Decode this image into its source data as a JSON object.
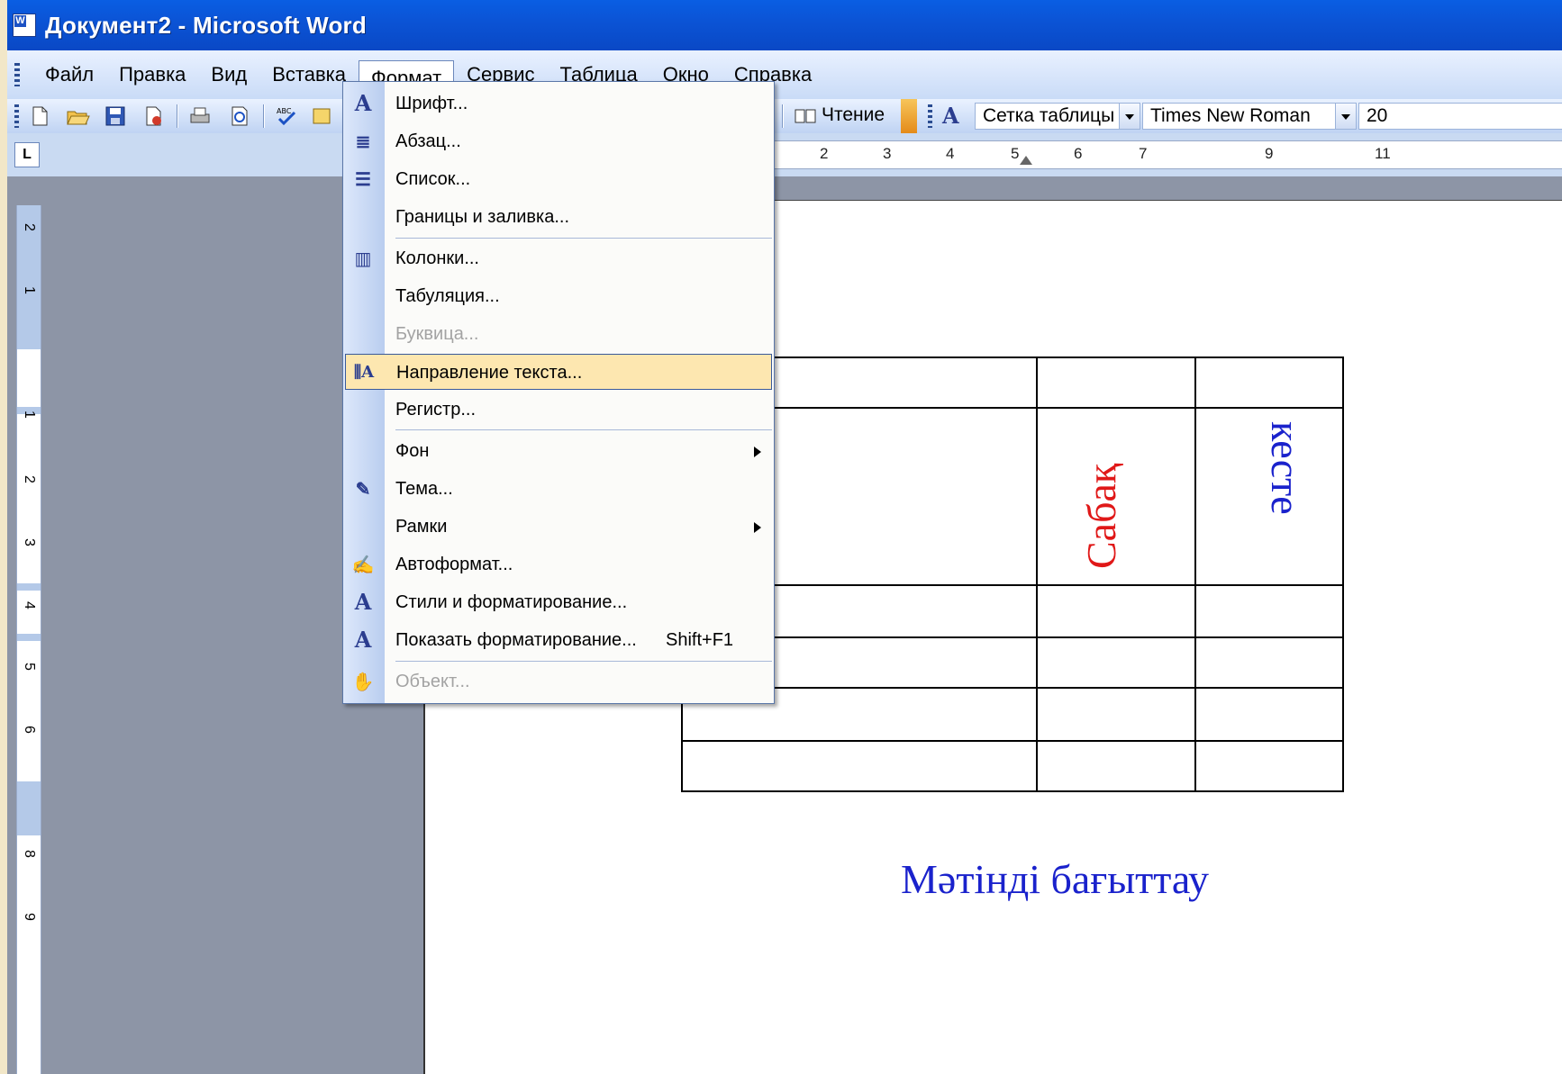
{
  "window": {
    "title": "Документ2 - Microsoft Word"
  },
  "menubar": {
    "items": [
      "Файл",
      "Правка",
      "Вид",
      "Вставка",
      "Формат",
      "Сервис",
      "Таблица",
      "Окно",
      "Справка"
    ],
    "active": "Формат"
  },
  "toolbar": {
    "reading_label": "Чтение",
    "style_value": "Сетка таблицы",
    "font_value": "Times New Roman",
    "size_value": "20"
  },
  "ruler": {
    "h_labels": [
      "2",
      "3",
      "4",
      "5",
      "6",
      "7",
      "9",
      "11"
    ]
  },
  "vruler": {
    "labels": [
      "2",
      "1",
      "1",
      "2",
      "3",
      "4",
      "5",
      "6",
      "8",
      "9"
    ]
  },
  "format_menu": {
    "items": [
      {
        "label": "Шрифт...",
        "icon": "font-icon"
      },
      {
        "label": "Абзац...",
        "icon": "paragraph-icon"
      },
      {
        "label": "Список...",
        "icon": "list-icon"
      },
      {
        "label": "Границы и заливка...",
        "icon": ""
      },
      {
        "label": "Колонки...",
        "icon": "columns-icon"
      },
      {
        "label": "Табуляция...",
        "icon": ""
      },
      {
        "label": "Буквица...",
        "icon": "",
        "disabled": true
      },
      {
        "label": "Направление текста...",
        "icon": "text-direction-icon",
        "highlighted": true
      },
      {
        "label": "Регистр...",
        "icon": ""
      },
      {
        "label": "Фон",
        "icon": "",
        "submenu": true
      },
      {
        "label": "Тема...",
        "icon": "theme-icon"
      },
      {
        "label": "Рамки",
        "icon": "",
        "submenu": true
      },
      {
        "label": "Автоформат...",
        "icon": "autoformat-icon"
      },
      {
        "label": "Стили и форматирование...",
        "icon": "styles-icon"
      },
      {
        "label": "Показать форматирование...",
        "icon": "reveal-formatting-icon",
        "shortcut": "Shift+F1"
      },
      {
        "label": "Объект...",
        "icon": "object-icon",
        "disabled": true
      }
    ]
  },
  "document": {
    "cell_text_red": "Сабақ",
    "cell_text_blue": "кесте",
    "caption": "Мәтінді бағыттау",
    "colors": {
      "red": "#e01818",
      "blue": "#1a22cc"
    }
  }
}
